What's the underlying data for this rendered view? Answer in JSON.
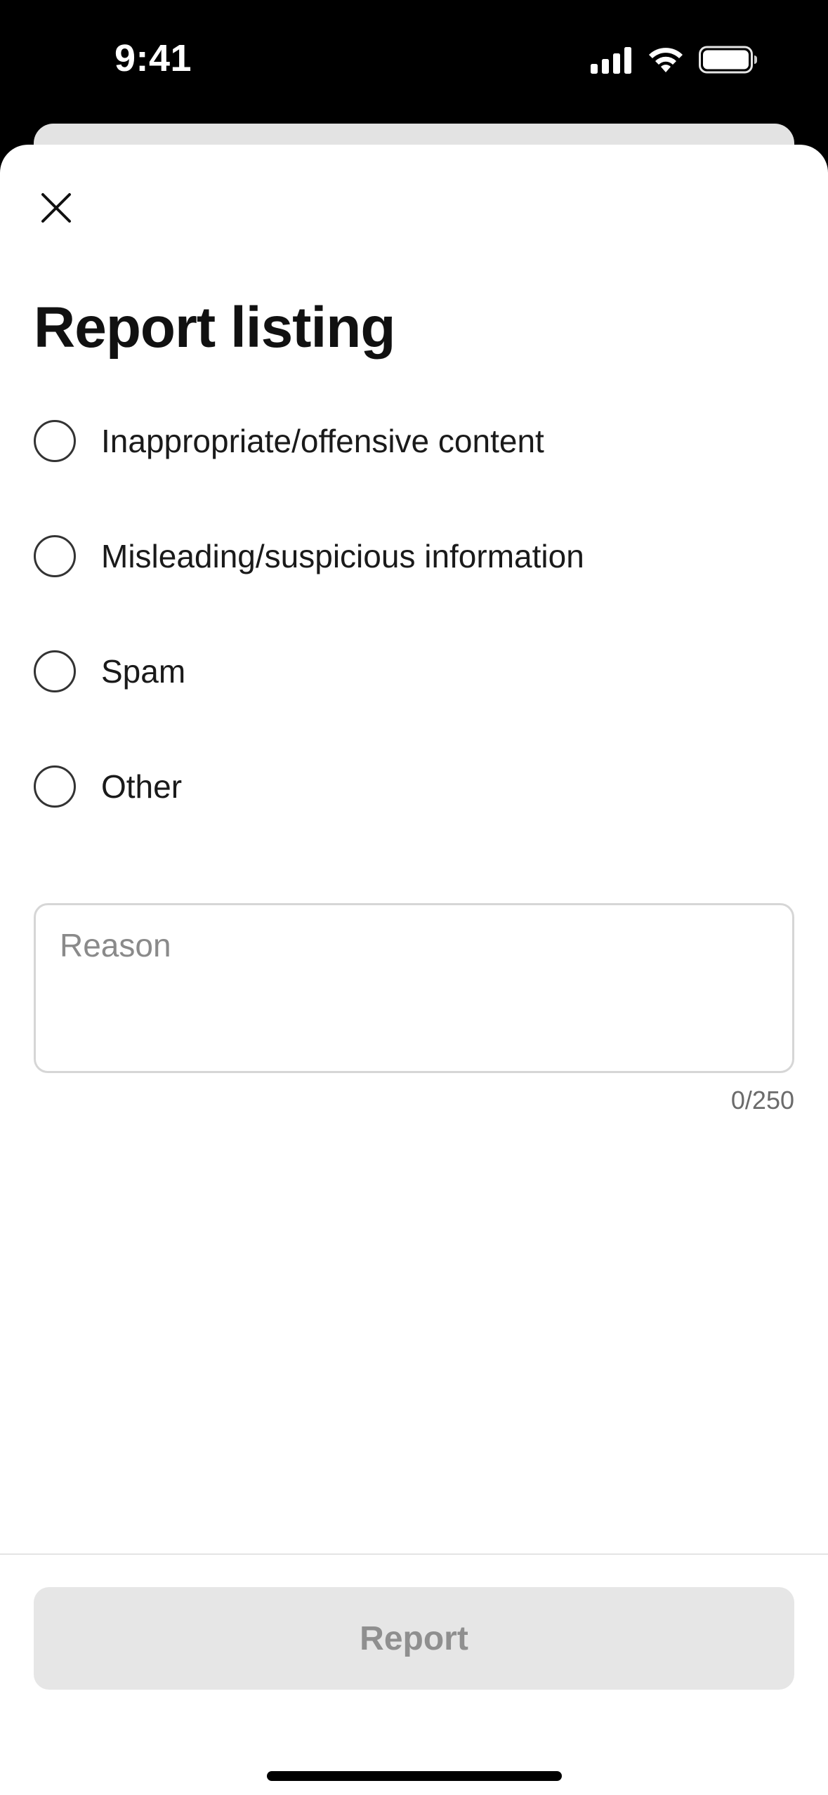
{
  "status_bar": {
    "time": "9:41",
    "icons": [
      "cellular-signal-icon",
      "wifi-icon",
      "battery-icon"
    ]
  },
  "sheet": {
    "close_icon": "close-icon",
    "title": "Report listing",
    "options": [
      {
        "label": "Inappropriate/offensive content",
        "selected": false
      },
      {
        "label": "Misleading/suspicious information",
        "selected": false
      },
      {
        "label": "Spam",
        "selected": false
      },
      {
        "label": "Other",
        "selected": false
      }
    ],
    "reason": {
      "placeholder": "Reason",
      "value": "",
      "counter": "0/250"
    },
    "report_button": {
      "label": "Report",
      "enabled": false
    }
  },
  "colors": {
    "background": "#000000",
    "sheet": "#ffffff",
    "text": "#111111",
    "placeholder": "#8a8a8a",
    "button_disabled_bg": "#e6e6e6",
    "button_disabled_text": "#8f8f8f"
  }
}
